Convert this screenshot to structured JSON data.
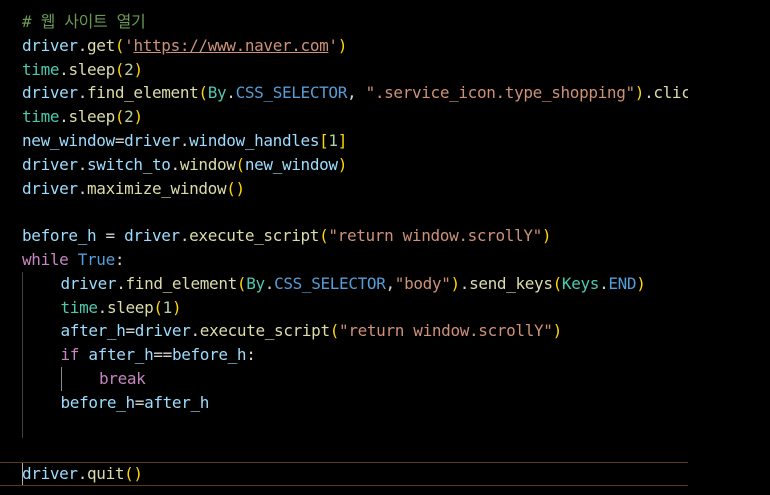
{
  "editor": {
    "colors": {
      "background": "#000000",
      "comment": "#6a9955",
      "string": "#ce9178",
      "keyword": "#c586c0",
      "constant": "#569cd6",
      "variable": "#9cdcfe",
      "function": "#dcdcaa",
      "class": "#4ec9b0",
      "number": "#b5cea8",
      "plain": "#d4d4d4",
      "bracket1": "#ffd700",
      "bracket2": "#da70d6",
      "bracket3": "#179fff"
    },
    "lines": [
      {
        "indent": 0,
        "tokens": [
          {
            "t": "# 웹 사이트 열기",
            "c": "comment"
          }
        ]
      },
      {
        "indent": 0,
        "tokens": [
          {
            "t": "driver",
            "c": "variable"
          },
          {
            "t": ".",
            "c": "plain"
          },
          {
            "t": "get",
            "c": "function"
          },
          {
            "t": "(",
            "c": "bracket1"
          },
          {
            "t": "'",
            "c": "string"
          },
          {
            "t": "https://www.naver.com",
            "c": "string",
            "u": true
          },
          {
            "t": "'",
            "c": "string"
          },
          {
            "t": ")",
            "c": "bracket1"
          }
        ]
      },
      {
        "indent": 0,
        "tokens": [
          {
            "t": "time",
            "c": "class"
          },
          {
            "t": ".",
            "c": "plain"
          },
          {
            "t": "sleep",
            "c": "function"
          },
          {
            "t": "(",
            "c": "bracket1"
          },
          {
            "t": "2",
            "c": "number"
          },
          {
            "t": ")",
            "c": "bracket1"
          }
        ]
      },
      {
        "indent": 0,
        "tokens": [
          {
            "t": "driver",
            "c": "variable"
          },
          {
            "t": ".",
            "c": "plain"
          },
          {
            "t": "find_element",
            "c": "function"
          },
          {
            "t": "(",
            "c": "bracket1"
          },
          {
            "t": "By",
            "c": "class"
          },
          {
            "t": ".",
            "c": "plain"
          },
          {
            "t": "CSS_SELECTOR",
            "c": "constant"
          },
          {
            "t": ", ",
            "c": "plain"
          },
          {
            "t": "\".service_icon.type_shopping\"",
            "c": "string"
          },
          {
            "t": ")",
            "c": "bracket1"
          },
          {
            "t": ".",
            "c": "plain"
          },
          {
            "t": "click",
            "c": "function"
          },
          {
            "t": "()",
            "c": "bracket1"
          }
        ]
      },
      {
        "indent": 0,
        "tokens": [
          {
            "t": "time",
            "c": "class"
          },
          {
            "t": ".",
            "c": "plain"
          },
          {
            "t": "sleep",
            "c": "function"
          },
          {
            "t": "(",
            "c": "bracket1"
          },
          {
            "t": "2",
            "c": "number"
          },
          {
            "t": ")",
            "c": "bracket1"
          }
        ]
      },
      {
        "indent": 0,
        "tokens": [
          {
            "t": "new_window",
            "c": "variable"
          },
          {
            "t": "=",
            "c": "plain"
          },
          {
            "t": "driver",
            "c": "variable"
          },
          {
            "t": ".",
            "c": "plain"
          },
          {
            "t": "window_handles",
            "c": "variable"
          },
          {
            "t": "[",
            "c": "bracket1"
          },
          {
            "t": "1",
            "c": "number"
          },
          {
            "t": "]",
            "c": "bracket1"
          }
        ]
      },
      {
        "indent": 0,
        "tokens": [
          {
            "t": "driver",
            "c": "variable"
          },
          {
            "t": ".",
            "c": "plain"
          },
          {
            "t": "switch_to",
            "c": "variable"
          },
          {
            "t": ".",
            "c": "plain"
          },
          {
            "t": "window",
            "c": "function"
          },
          {
            "t": "(",
            "c": "bracket1"
          },
          {
            "t": "new_window",
            "c": "variable"
          },
          {
            "t": ")",
            "c": "bracket1"
          }
        ]
      },
      {
        "indent": 0,
        "tokens": [
          {
            "t": "driver",
            "c": "variable"
          },
          {
            "t": ".",
            "c": "plain"
          },
          {
            "t": "maximize_window",
            "c": "function"
          },
          {
            "t": "()",
            "c": "bracket1"
          }
        ]
      },
      {
        "indent": 0,
        "tokens": []
      },
      {
        "indent": 0,
        "tokens": [
          {
            "t": "before_h",
            "c": "variable"
          },
          {
            "t": " = ",
            "c": "plain"
          },
          {
            "t": "driver",
            "c": "variable"
          },
          {
            "t": ".",
            "c": "plain"
          },
          {
            "t": "execute_script",
            "c": "function"
          },
          {
            "t": "(",
            "c": "bracket1"
          },
          {
            "t": "\"return window.scrollY\"",
            "c": "string"
          },
          {
            "t": ")",
            "c": "bracket1"
          }
        ]
      },
      {
        "indent": 0,
        "tokens": [
          {
            "t": "while",
            "c": "keyword"
          },
          {
            "t": " ",
            "c": "plain"
          },
          {
            "t": "True",
            "c": "constant"
          },
          {
            "t": ":",
            "c": "plain"
          }
        ]
      },
      {
        "indent": 1,
        "tokens": [
          {
            "t": "driver",
            "c": "variable"
          },
          {
            "t": ".",
            "c": "plain"
          },
          {
            "t": "find_element",
            "c": "function"
          },
          {
            "t": "(",
            "c": "bracket1"
          },
          {
            "t": "By",
            "c": "class"
          },
          {
            "t": ".",
            "c": "plain"
          },
          {
            "t": "CSS_SELECTOR",
            "c": "constant"
          },
          {
            "t": ",",
            "c": "plain"
          },
          {
            "t": "\"body\"",
            "c": "string"
          },
          {
            "t": ")",
            "c": "bracket1"
          },
          {
            "t": ".",
            "c": "plain"
          },
          {
            "t": "send_keys",
            "c": "function"
          },
          {
            "t": "(",
            "c": "bracket1"
          },
          {
            "t": "Keys",
            "c": "class"
          },
          {
            "t": ".",
            "c": "plain"
          },
          {
            "t": "END",
            "c": "constant"
          },
          {
            "t": ")",
            "c": "bracket1"
          }
        ]
      },
      {
        "indent": 1,
        "tokens": [
          {
            "t": "time",
            "c": "class"
          },
          {
            "t": ".",
            "c": "plain"
          },
          {
            "t": "sleep",
            "c": "function"
          },
          {
            "t": "(",
            "c": "bracket1"
          },
          {
            "t": "1",
            "c": "number"
          },
          {
            "t": ")",
            "c": "bracket1"
          }
        ]
      },
      {
        "indent": 1,
        "tokens": [
          {
            "t": "after_h",
            "c": "variable"
          },
          {
            "t": "=",
            "c": "plain"
          },
          {
            "t": "driver",
            "c": "variable"
          },
          {
            "t": ".",
            "c": "plain"
          },
          {
            "t": "execute_script",
            "c": "function"
          },
          {
            "t": "(",
            "c": "bracket1"
          },
          {
            "t": "\"return window.scrollY\"",
            "c": "string"
          },
          {
            "t": ")",
            "c": "bracket1"
          }
        ]
      },
      {
        "indent": 1,
        "tokens": [
          {
            "t": "if",
            "c": "keyword"
          },
          {
            "t": " ",
            "c": "plain"
          },
          {
            "t": "after_h",
            "c": "variable"
          },
          {
            "t": "==",
            "c": "plain"
          },
          {
            "t": "before_h",
            "c": "variable"
          },
          {
            "t": ":",
            "c": "plain"
          }
        ]
      },
      {
        "indent": 2,
        "tokens": [
          {
            "t": "break",
            "c": "keyword"
          }
        ]
      },
      {
        "indent": 1,
        "tokens": [
          {
            "t": "before_h",
            "c": "variable"
          },
          {
            "t": "=",
            "c": "plain"
          },
          {
            "t": "after_h",
            "c": "variable"
          }
        ]
      },
      {
        "indent": 0,
        "tokens": []
      },
      {
        "indent": 0,
        "tokens": []
      },
      {
        "indent": 0,
        "current": true,
        "tokens": [
          {
            "t": "driver",
            "c": "variable"
          },
          {
            "t": ".",
            "c": "plain"
          },
          {
            "t": "quit",
            "c": "function"
          },
          {
            "t": "()",
            "c": "bracket1"
          }
        ]
      }
    ]
  }
}
